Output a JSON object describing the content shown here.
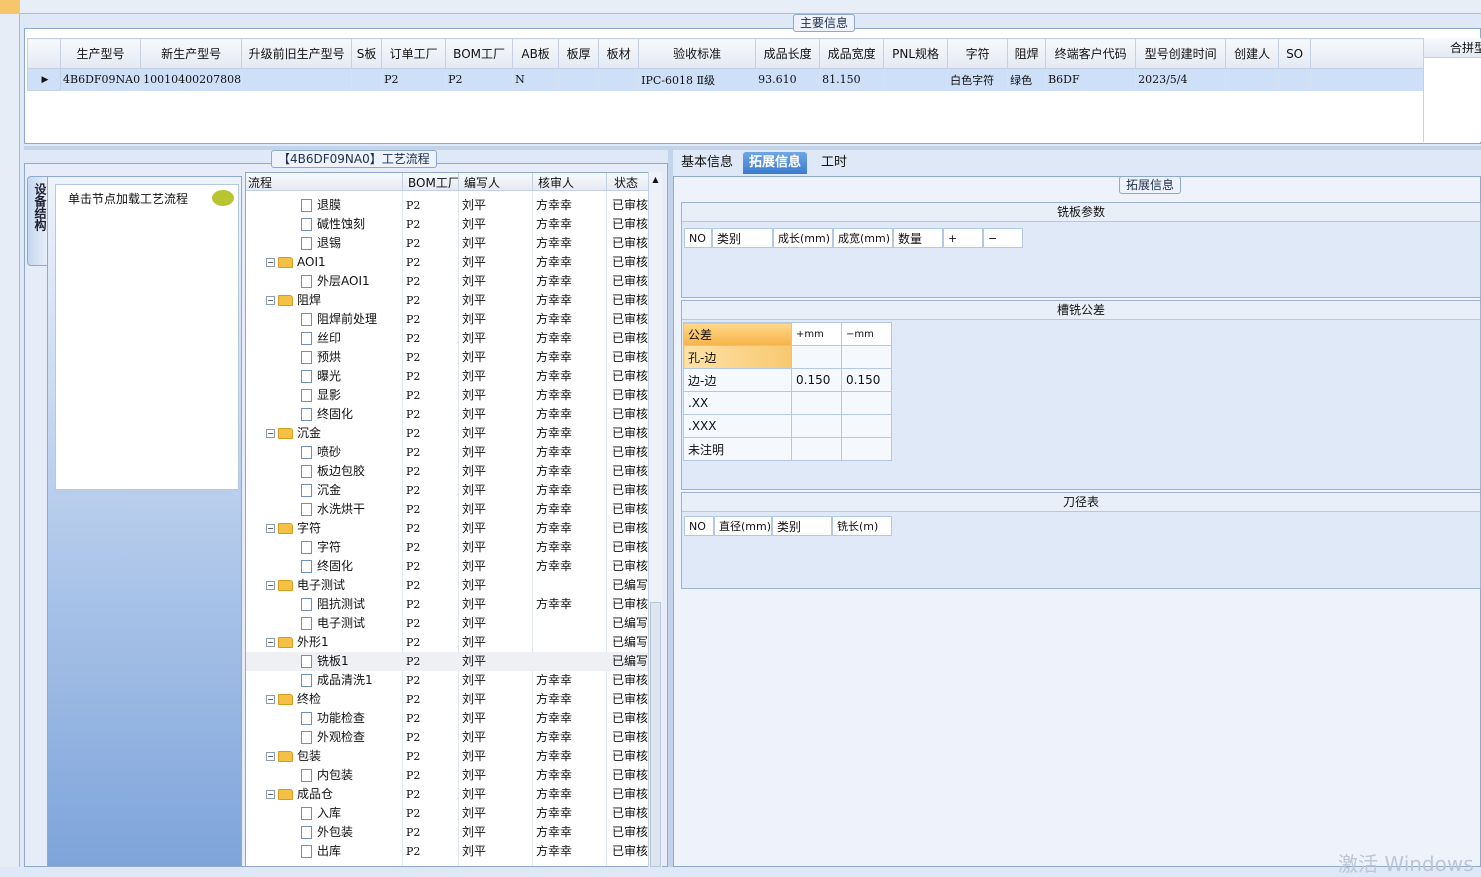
{
  "main_info": {
    "legend": "主要信息",
    "columns": [
      "生产型号",
      "新生产型号",
      "升级前旧生产型号",
      "S板",
      "订单工厂",
      "BOM工厂",
      "AB板",
      "板厚",
      "板材",
      "验收标准",
      "成品长度",
      "成品宽度",
      "PNL规格",
      "字符",
      "阻焊",
      "终端客户代码",
      "型号创建时间",
      "创建人",
      "SO"
    ],
    "row": [
      "4B6DF09NA0",
      "10010400207808",
      "",
      "",
      "P2",
      "P2",
      "N",
      "",
      "",
      "IPC-6018 Ⅱ级",
      "93.610",
      "81.150",
      "",
      "白色字符",
      "绿色",
      "B6DF",
      "2023/5/4",
      "",
      ""
    ],
    "right_label": "合拼型"
  },
  "process": {
    "legend": "【4B6DF09NA0】工艺流程",
    "side_tab": "设备结构",
    "side_hint": "单击节点加载工艺流程",
    "columns": [
      "流程",
      "BOM工厂",
      "编写人",
      "核审人",
      "状态"
    ],
    "rows": [
      {
        "level": 2,
        "name": "退膜",
        "f": "P2",
        "w": "刘平",
        "r": "方幸幸",
        "s": "已审核"
      },
      {
        "level": 2,
        "name": "碱性蚀刻",
        "f": "P2",
        "w": "刘平",
        "r": "方幸幸",
        "s": "已审核"
      },
      {
        "level": 2,
        "name": "退锡",
        "f": "P2",
        "w": "刘平",
        "r": "方幸幸",
        "s": "已审核"
      },
      {
        "level": 1,
        "name": "AOI1",
        "f": "P2",
        "w": "刘平",
        "r": "方幸幸",
        "s": "已审核"
      },
      {
        "level": 2,
        "name": "外层AOI1",
        "f": "P2",
        "w": "刘平",
        "r": "方幸幸",
        "s": "已审核"
      },
      {
        "level": 1,
        "name": "阻焊",
        "f": "P2",
        "w": "刘平",
        "r": "方幸幸",
        "s": "已审核"
      },
      {
        "level": 2,
        "name": "阻焊前处理",
        "f": "P2",
        "w": "刘平",
        "r": "方幸幸",
        "s": "已审核"
      },
      {
        "level": 2,
        "name": "丝印",
        "f": "P2",
        "w": "刘平",
        "r": "方幸幸",
        "s": "已审核"
      },
      {
        "level": 2,
        "name": "预烘",
        "f": "P2",
        "w": "刘平",
        "r": "方幸幸",
        "s": "已审核"
      },
      {
        "level": 2,
        "name": "曝光",
        "f": "P2",
        "w": "刘平",
        "r": "方幸幸",
        "s": "已审核"
      },
      {
        "level": 2,
        "name": "显影",
        "f": "P2",
        "w": "刘平",
        "r": "方幸幸",
        "s": "已审核"
      },
      {
        "level": 2,
        "name": "终固化",
        "f": "P2",
        "w": "刘平",
        "r": "方幸幸",
        "s": "已审核"
      },
      {
        "level": 1,
        "name": "沉金",
        "f": "P2",
        "w": "刘平",
        "r": "方幸幸",
        "s": "已审核"
      },
      {
        "level": 2,
        "name": "喷砂",
        "f": "P2",
        "w": "刘平",
        "r": "方幸幸",
        "s": "已审核"
      },
      {
        "level": 2,
        "name": "板边包胶",
        "f": "P2",
        "w": "刘平",
        "r": "方幸幸",
        "s": "已审核"
      },
      {
        "level": 2,
        "name": "沉金",
        "f": "P2",
        "w": "刘平",
        "r": "方幸幸",
        "s": "已审核"
      },
      {
        "level": 2,
        "name": "水洗烘干",
        "f": "P2",
        "w": "刘平",
        "r": "方幸幸",
        "s": "已审核"
      },
      {
        "level": 1,
        "name": "字符",
        "f": "P2",
        "w": "刘平",
        "r": "方幸幸",
        "s": "已审核"
      },
      {
        "level": 2,
        "name": "字符",
        "f": "P2",
        "w": "刘平",
        "r": "方幸幸",
        "s": "已审核"
      },
      {
        "level": 2,
        "name": "终固化",
        "f": "P2",
        "w": "刘平",
        "r": "方幸幸",
        "s": "已审核"
      },
      {
        "level": 1,
        "name": "电子测试",
        "f": "P2",
        "w": "刘平",
        "r": "",
        "s": "已编写"
      },
      {
        "level": 2,
        "name": "阻抗测试",
        "f": "P2",
        "w": "刘平",
        "r": "方幸幸",
        "s": "已审核"
      },
      {
        "level": 2,
        "name": "电子测试",
        "f": "P2",
        "w": "刘平",
        "r": "",
        "s": "已编写"
      },
      {
        "level": 1,
        "name": "外形1",
        "f": "P2",
        "w": "刘平",
        "r": "",
        "s": "已编写"
      },
      {
        "level": 2,
        "name": "铣板1",
        "f": "P2",
        "w": "刘平",
        "r": "",
        "s": "已编写"
      },
      {
        "level": 2,
        "name": "成品清洗1",
        "f": "P2",
        "w": "刘平",
        "r": "方幸幸",
        "s": "已审核"
      },
      {
        "level": 1,
        "name": "终检",
        "f": "P2",
        "w": "刘平",
        "r": "方幸幸",
        "s": "已审核"
      },
      {
        "level": 2,
        "name": "功能检查",
        "f": "P2",
        "w": "刘平",
        "r": "方幸幸",
        "s": "已审核"
      },
      {
        "level": 2,
        "name": "外观检查",
        "f": "P2",
        "w": "刘平",
        "r": "方幸幸",
        "s": "已审核"
      },
      {
        "level": 1,
        "name": "包装",
        "f": "P2",
        "w": "刘平",
        "r": "方幸幸",
        "s": "已审核"
      },
      {
        "level": 2,
        "name": "内包装",
        "f": "P2",
        "w": "刘平",
        "r": "方幸幸",
        "s": "已审核"
      },
      {
        "level": 1,
        "name": "成品仓",
        "f": "P2",
        "w": "刘平",
        "r": "方幸幸",
        "s": "已审核"
      },
      {
        "level": 2,
        "name": "入库",
        "f": "P2",
        "w": "刘平",
        "r": "方幸幸",
        "s": "已审核"
      },
      {
        "level": 2,
        "name": "外包装",
        "f": "P2",
        "w": "刘平",
        "r": "方幸幸",
        "s": "已审核"
      },
      {
        "level": 2,
        "name": "出库",
        "f": "P2",
        "w": "刘平",
        "r": "方幸幸",
        "s": "已审核"
      }
    ]
  },
  "tabs": [
    "基本信息",
    "拓展信息",
    "工时"
  ],
  "ext": {
    "legend": "拓展信息",
    "mill_title": "铣板参数",
    "mill_cols": [
      "NO",
      "类别",
      "成长(mm)",
      "成宽(mm)",
      "数量",
      "+",
      "−"
    ],
    "tol_title": "槽铣公差",
    "tol_head": [
      "公差",
      "+mm",
      "−mm"
    ],
    "tol_rows": [
      [
        "孔-边",
        "",
        ""
      ],
      [
        "边-边",
        "0.150",
        "0.150"
      ],
      [
        ".XX",
        "",
        ""
      ],
      [
        ".XXX",
        "",
        ""
      ],
      [
        "未注明",
        "",
        ""
      ]
    ],
    "knife_title": "刀径表",
    "knife_cols": [
      "NO",
      "直径(mm)",
      "类别",
      "铣长(m)"
    ]
  },
  "watermark": "激活 Windows"
}
